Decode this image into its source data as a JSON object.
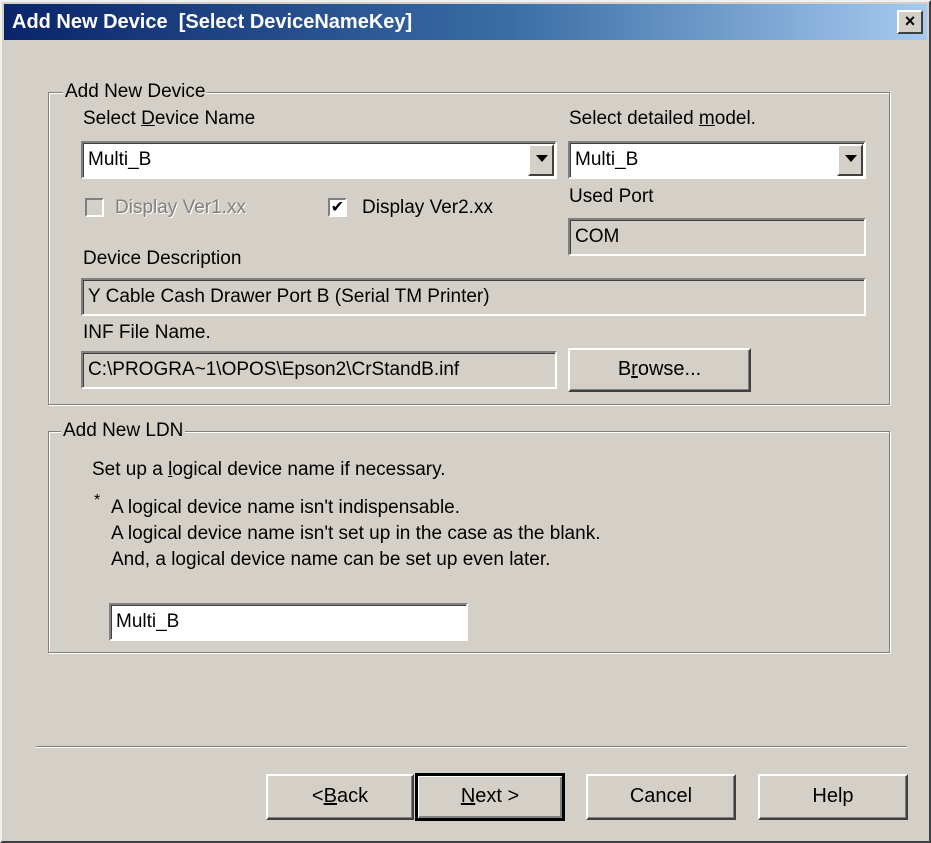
{
  "window": {
    "title": "Add New Device  [Select DeviceNameKey]",
    "close_label": "×"
  },
  "device_group": {
    "legend": "Add New Device",
    "device_name_label_pre": "Select ",
    "device_name_label_key": "D",
    "device_name_label_post": "evice Name",
    "device_name_value": "Multi_B",
    "model_label_pre": "Select detailed ",
    "model_label_key": "m",
    "model_label_post": "odel.",
    "model_value": "Multi_B",
    "display_v1_label": "Display Ver1.xx",
    "display_v1_checked": false,
    "display_v2_label": "Display Ver2.xx",
    "display_v2_checked": true,
    "check_mark": "✔",
    "used_port_label": "Used Port",
    "used_port_value": "COM",
    "description_label": "Device Description",
    "description_value": "Y Cable Cash Drawer Port B (Serial TM Printer)",
    "inf_label": "INF File Name.",
    "inf_value": "C:\\PROGRA~1\\OPOS\\Epson2\\CrStandB.inf",
    "browse_pre": "B",
    "browse_key": "r",
    "browse_post": "owse..."
  },
  "ldn_group": {
    "legend": "Add New LDN",
    "setup_pre": "Set up a ",
    "setup_key": "l",
    "setup_post": "ogical device name if necessary.",
    "note_marker": "*",
    "note_line1": "A logical device name isn't indispensable.",
    "note_line2": "A logical device name isn't set up in the case as the blank.",
    "note_line3": "And, a logical device name can be set up even later.",
    "ldn_value": "Multi_B"
  },
  "buttons": {
    "back_pre": "< ",
    "back_key": "B",
    "back_post": "ack",
    "next_key": "N",
    "next_post": "ext >",
    "cancel": "Cancel",
    "help": "Help"
  }
}
